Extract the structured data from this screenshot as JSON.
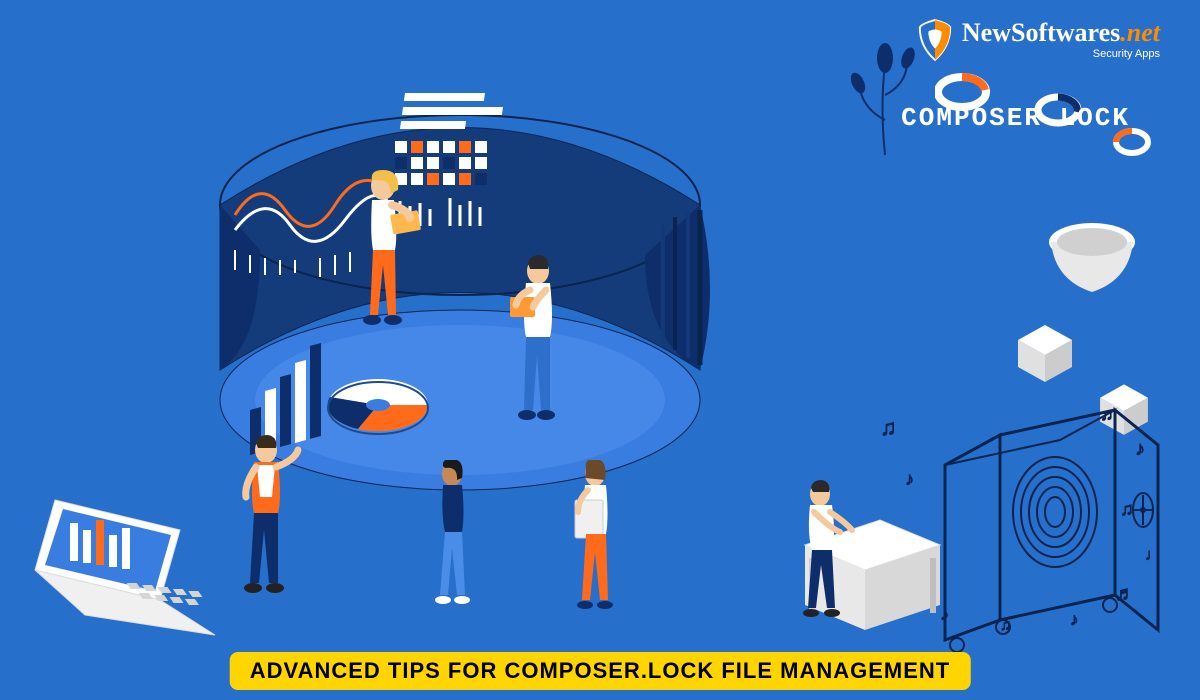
{
  "logo": {
    "brand_main": "NewSoftwares",
    "brand_suffix": ".net",
    "tagline": "Security Apps"
  },
  "labels": {
    "composer": "COMPOSER.LOCK"
  },
  "banner": {
    "text": "ADVANCED TIPS FOR COMPOSER.LOCK FILE MANAGEMENT"
  },
  "colors": {
    "background": "#2670cc",
    "panel_dark": "#0e2e6b",
    "panel_mid": "#1d4a8f",
    "accent_orange": "#ff6b1a",
    "accent_yellow": "#ffd500",
    "white": "#ffffff"
  },
  "icons": {
    "logo_shield": "shield-icon",
    "donut_chart": "donut-chart-icon",
    "bar_chart": "bar-chart-icon",
    "line_chart": "line-chart-icon",
    "cube": "cube-icon",
    "laptop": "laptop-icon",
    "vault": "vault-icon",
    "music_note": "music-note-icon",
    "plant": "plant-icon",
    "pot": "pot-icon"
  }
}
